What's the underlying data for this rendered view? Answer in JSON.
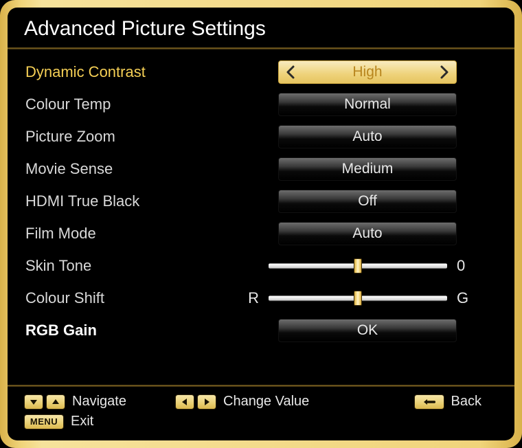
{
  "title": "Advanced Picture Settings",
  "settings": {
    "dynamic_contrast": {
      "label": "Dynamic Contrast",
      "value": "High",
      "type": "select",
      "selected": true
    },
    "colour_temp": {
      "label": "Colour Temp",
      "value": "Normal",
      "type": "select"
    },
    "picture_zoom": {
      "label": "Picture Zoom",
      "value": "Auto",
      "type": "select"
    },
    "movie_sense": {
      "label": "Movie Sense",
      "value": "Medium",
      "type": "select"
    },
    "hdmi_true_black": {
      "label": "HDMI True Black",
      "value": "Off",
      "type": "select"
    },
    "film_mode": {
      "label": "Film Mode",
      "value": "Auto",
      "type": "select"
    },
    "skin_tone": {
      "label": "Skin Tone",
      "type": "slider",
      "left": "",
      "right": "0",
      "pos": 0.5
    },
    "colour_shift": {
      "label": "Colour Shift",
      "type": "slider",
      "left": "R",
      "right": "G",
      "pos": 0.5
    },
    "rgb_gain": {
      "label": "RGB Gain",
      "value": "OK",
      "type": "button"
    }
  },
  "legend": {
    "navigate": "Navigate",
    "change_value": "Change Value",
    "back": "Back",
    "menu": "MENU",
    "exit": "Exit"
  }
}
